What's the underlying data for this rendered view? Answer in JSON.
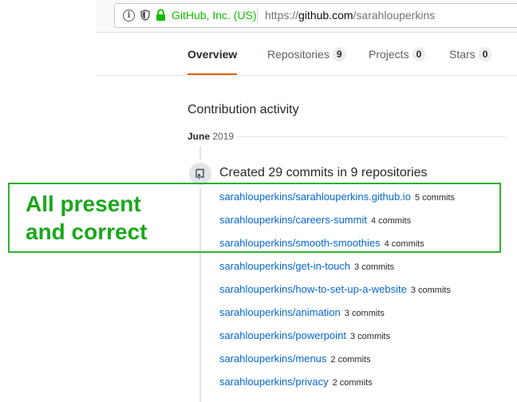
{
  "browser": {
    "site_identity": "GitHub, Inc. (US)",
    "url_scheme": "https://",
    "url_host": "github.com",
    "url_path": "/sarahlouperkins"
  },
  "tabs": [
    {
      "label": "Overview",
      "count": null,
      "selected": true
    },
    {
      "label": "Repositories",
      "count": "9",
      "selected": false
    },
    {
      "label": "Projects",
      "count": "0",
      "selected": false
    },
    {
      "label": "Stars",
      "count": "0",
      "selected": false
    }
  ],
  "activity": {
    "title": "Contribution activity",
    "month_name": "June",
    "month_year": "2019",
    "summary": "Created 29 commits in 9 repositories",
    "repos": [
      {
        "name": "sarahlouperkins/sarahlouperkins.github.io",
        "commits": "5 commits"
      },
      {
        "name": "sarahlouperkins/careers-summit",
        "commits": "4 commits"
      },
      {
        "name": "sarahlouperkins/smooth-smoothies",
        "commits": "4 commits"
      },
      {
        "name": "sarahlouperkins/get-in-touch",
        "commits": "3 commits"
      },
      {
        "name": "sarahlouperkins/how-to-set-up-a-website",
        "commits": "3 commits"
      },
      {
        "name": "sarahlouperkins/animation",
        "commits": "3 commits"
      },
      {
        "name": "sarahlouperkins/powerpoint",
        "commits": "3 commits"
      },
      {
        "name": "sarahlouperkins/menus",
        "commits": "2 commits"
      },
      {
        "name": "sarahlouperkins/privacy",
        "commits": "2 commits"
      }
    ]
  },
  "annotation": {
    "text": "All present\nand correct",
    "color": "#1aa81a"
  },
  "icons": {
    "info": "info-icon",
    "shield": "tracking-shield-icon",
    "lock": "lock-icon",
    "commit": "repo-push-icon"
  }
}
